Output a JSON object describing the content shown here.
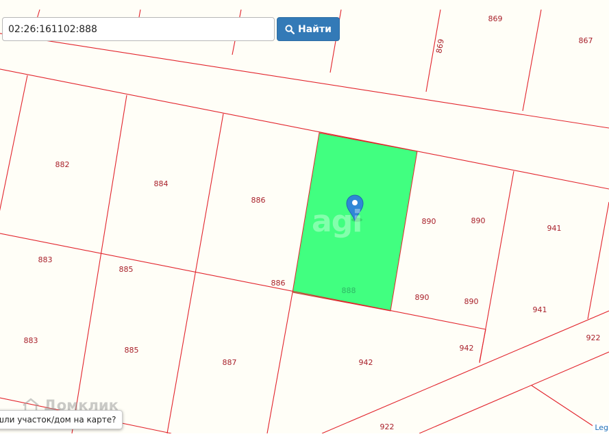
{
  "search": {
    "value": "02:26:161102:888",
    "button_label": "Найти"
  },
  "map": {
    "colors": {
      "background": "#fffef7",
      "boundary": "#e2232b",
      "highlight": "#41ff80",
      "label": "#a8202a",
      "marker": "#2f87d6"
    },
    "selected_parcel": "888",
    "watermark": "agi",
    "parcel_labels": [
      "869",
      "869",
      "867",
      "882",
      "884",
      "886",
      "890",
      "890",
      "941",
      "883",
      "885",
      "886",
      "888",
      "890",
      "890",
      "941",
      "883",
      "885",
      "887",
      "942",
      "942",
      "922",
      "922"
    ]
  },
  "footer": {
    "found_prompt": "шли участок/дом на карте?",
    "logo_text": "Домклик",
    "legend_label": "Leg"
  }
}
